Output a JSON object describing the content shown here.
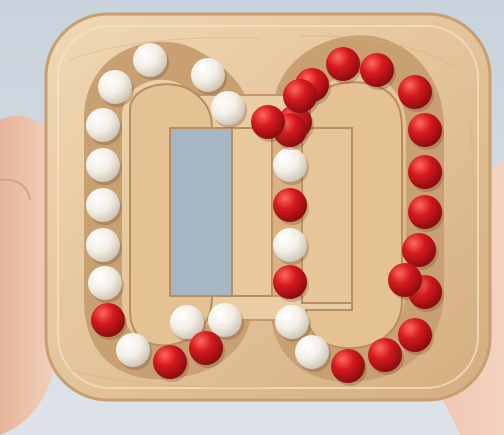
{
  "scene": {
    "subject": "wooden-bead-maze-puzzle",
    "colors": {
      "background": "#d2dae2",
      "wood_light": "#ecd3ad",
      "wood_mid": "#dcb98c",
      "wood_dark": "#b98e5f",
      "groove": "#c79a6a",
      "bead_white": "#f7f3ea",
      "bead_red": "#d0141b",
      "skin": "#edc4ad",
      "window_blue": "#a9b8c6"
    },
    "beads": {
      "white_count": 16,
      "red_count": 22
    }
  }
}
